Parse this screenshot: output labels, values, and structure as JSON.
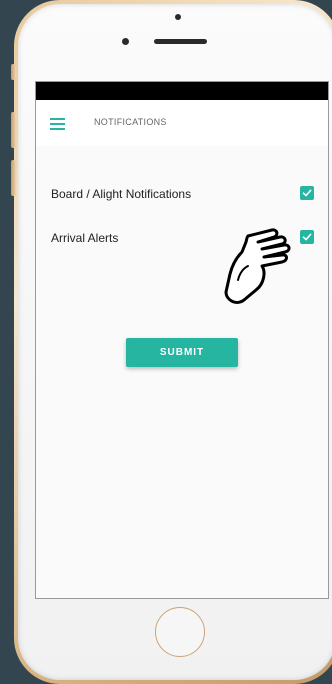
{
  "app_bar": {
    "title": "NOTIFICATIONS",
    "menu_icon": "hamburger-menu-icon"
  },
  "settings": [
    {
      "label": "Board / Alight Notifications",
      "checked": true
    },
    {
      "label": "Arrival Alerts",
      "checked": true
    }
  ],
  "submit_label": "SUBMIT",
  "colors": {
    "accent": "#26b5a0",
    "background": "#334650",
    "phone_frame": "#e8c89a",
    "status_bar": "#000000"
  },
  "icons": {
    "checkbox_check": "check-icon",
    "pointer": "pointing-hand-icon"
  }
}
